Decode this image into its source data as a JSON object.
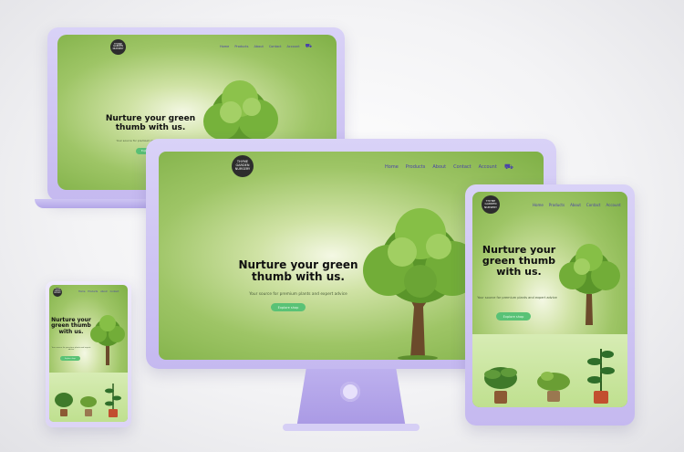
{
  "site": {
    "logo_text": "THYME GARDEN NURSERY",
    "nav": [
      "Home",
      "Products",
      "About",
      "Contact",
      "Account"
    ],
    "headline_desktop": "Nurture your green thumb with us.",
    "headline_tablet": "Nurture your green thumb with us.",
    "headline_phone": "Nurture your green thumb with us.",
    "tagline": "Your source for premium plants and expert advice",
    "cta_label": "Explore shop"
  },
  "colors": {
    "device_frame": "#c8bdf2",
    "screen_green": "#8fbd57",
    "cta_green": "#59c276",
    "nav_text": "#4a43a8"
  },
  "icons": [
    "cart-icon",
    "tree-illustration",
    "plant-pot-icon",
    "camera-dot-icon"
  ]
}
